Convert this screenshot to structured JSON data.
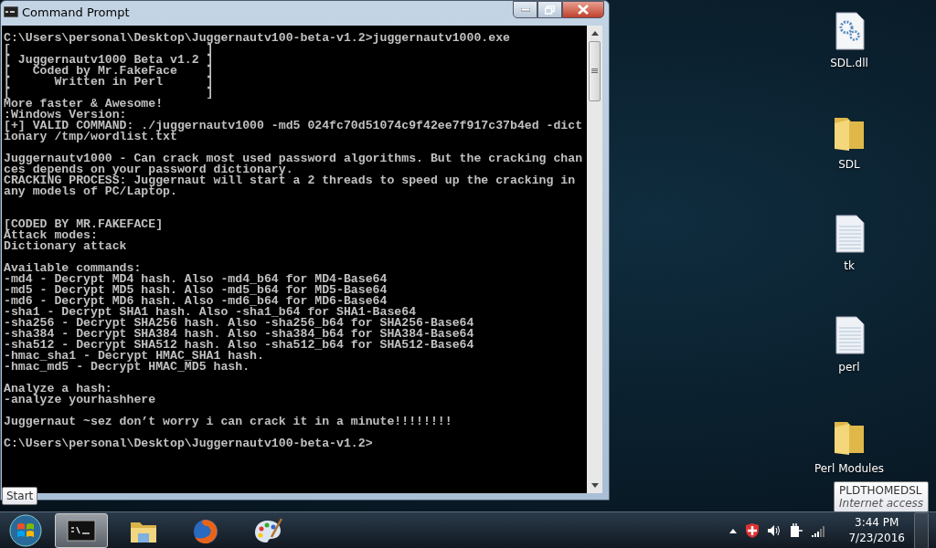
{
  "window": {
    "title": "Command Prompt"
  },
  "console": {
    "lines": [
      {
        "kind": "line",
        "text": "C:\\Users\\personal\\Desktop\\Juggernautv100-beta-v1.2>juggernautv1000.exe"
      },
      {
        "kind": "line",
        "text": "[                           ]"
      },
      {
        "kind": "line",
        "text": "[ Juggernautv1000 Beta v1.2 ]"
      },
      {
        "kind": "line",
        "text": "[   Coded by Mr.FakeFace    ]"
      },
      {
        "kind": "line",
        "text": "[      Written in Perl      ]"
      },
      {
        "kind": "line",
        "text": "[                           ]"
      },
      {
        "kind": "line",
        "text": "More faster & Awesome!"
      },
      {
        "kind": "line",
        "text": ":Windows Version:"
      },
      {
        "kind": "line",
        "text": "[+] VALID COMMAND: ./juggernautv1000 -md5 024fc70d51074c9f42ee7f917c37b4ed -dict"
      },
      {
        "kind": "line",
        "text": "ionary /tmp/wordlist.txt"
      },
      {
        "kind": "gap"
      },
      {
        "kind": "line",
        "text": "Juggernautv1000 - Can crack most used password algorithms. But the cracking chan"
      },
      {
        "kind": "line",
        "text": "ces depends on your password dictionary."
      },
      {
        "kind": "line",
        "text": "CRACKING PROCESS: Juggernaut will start a 2 threads to speed up the cracking in"
      },
      {
        "kind": "line",
        "text": "any models of PC/Laptop."
      },
      {
        "kind": "gap"
      },
      {
        "kind": "gap"
      },
      {
        "kind": "line",
        "text": "[CODED BY MR.FAKEFACE]"
      },
      {
        "kind": "line",
        "text": "Attack modes:"
      },
      {
        "kind": "line",
        "text": "Dictionary attack"
      },
      {
        "kind": "gap"
      },
      {
        "kind": "line",
        "text": "Available commands:"
      },
      {
        "kind": "line",
        "text": "-md4 - Decrypt MD4 hash. Also -md4_b64 for MD4-Base64"
      },
      {
        "kind": "line",
        "text": "-md5 - Decrypt MD5 hash. Also -md5_b64 for MD5-Base64"
      },
      {
        "kind": "line",
        "text": "-md6 - Decrypt MD6 hash. Also -md6_b64 for MD6-Base64"
      },
      {
        "kind": "line",
        "text": "-sha1 - Decrypt SHA1 hash. Also -sha1_b64 for SHA1-Base64"
      },
      {
        "kind": "line",
        "text": "-sha256 - Decrypt SHA256 hash. Also -sha256_b64 for SHA256-Base64"
      },
      {
        "kind": "line",
        "text": "-sha384 - Decrypt SHA384 hash. Also -sha384_b64 for SHA384-Base64"
      },
      {
        "kind": "line",
        "text": "-sha512 - Decrypt SHA512 hash. Also -sha512_b64 for SHA512-Base64"
      },
      {
        "kind": "line",
        "text": "-hmac_sha1 - Decrypt HMAC_SHA1 hash."
      },
      {
        "kind": "line",
        "text": "-hmac_md5 - Decrypt HMAC_MD5 hash."
      },
      {
        "kind": "gap"
      },
      {
        "kind": "line",
        "text": "Analyze a hash:"
      },
      {
        "kind": "line",
        "text": "-analyze yourhashhere"
      },
      {
        "kind": "gap"
      },
      {
        "kind": "line",
        "text": "Juggernaut ~sez don’t worry i can crack it in a minute!!!!!!!!"
      },
      {
        "kind": "gap"
      },
      {
        "kind": "line",
        "text": "C:\\Users\\personal\\Desktop\\Juggernautv100-beta-v1.2>"
      }
    ]
  },
  "desktop_icons": [
    {
      "kind": "dll",
      "label": "SDL.dll"
    },
    {
      "kind": "folder",
      "label": "SDL"
    },
    {
      "kind": "file",
      "label": "tk"
    },
    {
      "kind": "file",
      "label": "perl"
    },
    {
      "kind": "folder",
      "label": "Perl Modules"
    }
  ],
  "start_tooltip": "Start",
  "network_tooltip": {
    "name": "PLDTHOMEDSL",
    "status": "Internet access"
  },
  "taskbar": {
    "apps": [
      {
        "kind": "console",
        "selected": true
      },
      {
        "kind": "explorer",
        "selected": false
      },
      {
        "kind": "browser",
        "selected": false
      },
      {
        "kind": "paint",
        "selected": false
      }
    ]
  },
  "clock": {
    "time": "3:44 PM",
    "date": "7/23/2016"
  }
}
